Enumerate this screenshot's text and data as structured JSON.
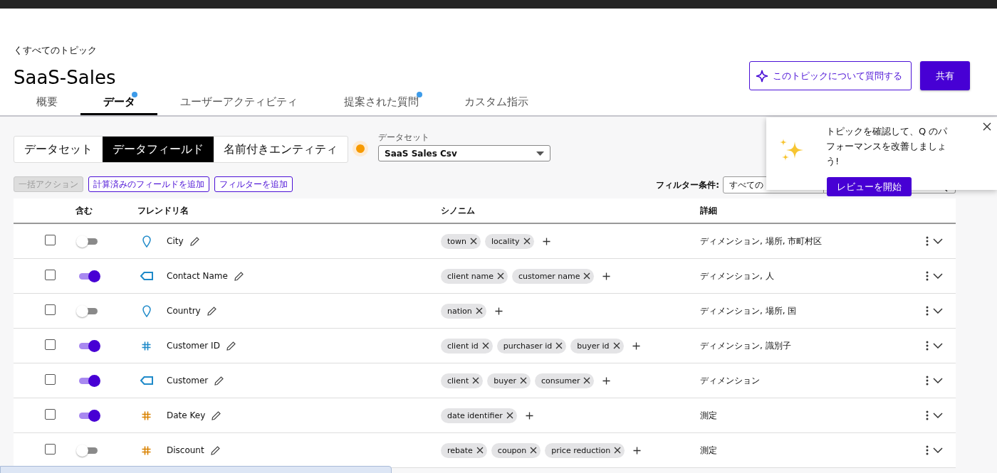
{
  "header": {
    "back_link": "くすべてのトピック",
    "title": "SaaS-Sales",
    "ask_button": "このトピックについて質問する",
    "share_button": "共有"
  },
  "tabs": [
    {
      "label": "概要",
      "selected": false,
      "dot": false
    },
    {
      "label": "データ",
      "selected": true,
      "dot": true
    },
    {
      "label": "ユーザーアクティビティ",
      "selected": false,
      "dot": false
    },
    {
      "label": "提案された質問",
      "selected": false,
      "dot": true
    },
    {
      "label": "カスタム指示",
      "selected": false,
      "dot": false
    }
  ],
  "segments": [
    {
      "label": "データセット",
      "selected": false
    },
    {
      "label": "データフィールド",
      "selected": true
    },
    {
      "label": "名前付きエンティティ",
      "selected": false
    }
  ],
  "dataset": {
    "label": "データセット",
    "value": "SaaS Sales Csv"
  },
  "actions": [
    {
      "label": "一括アクション",
      "disabled": true
    },
    {
      "label": "計算済みのフィールドを追加",
      "disabled": false
    },
    {
      "label": "フィルターを追加",
      "disabled": false
    }
  ],
  "filter": {
    "label": "フィルター条件:",
    "value": "すべての"
  },
  "table": {
    "columns": [
      "含む",
      "フレンドリ名",
      "シノニム",
      "詳細"
    ],
    "rows": [
      {
        "checked": false,
        "included": false,
        "kind": "location",
        "color": "#1f8ac9",
        "name": "City",
        "synonyms": [
          "town",
          "locality"
        ],
        "details": "ディメンション, 場所, 市町村区"
      },
      {
        "checked": false,
        "included": true,
        "kind": "text",
        "color": "#1f8ac9",
        "name": "Contact Name",
        "synonyms": [
          "client name",
          "customer name"
        ],
        "details": "ディメンション, 人"
      },
      {
        "checked": false,
        "included": false,
        "kind": "location",
        "color": "#1f8ac9",
        "name": "Country",
        "synonyms": [
          "nation"
        ],
        "details": "ディメンション, 場所, 国"
      },
      {
        "checked": false,
        "included": true,
        "kind": "number",
        "color": "#1f8ac9",
        "name": "Customer ID",
        "synonyms": [
          "client id",
          "purchaser id",
          "buyer id"
        ],
        "details": "ディメンション, 識別子"
      },
      {
        "checked": false,
        "included": true,
        "kind": "text",
        "color": "#1f8ac9",
        "name": "Customer",
        "synonyms": [
          "client",
          "buyer",
          "consumer"
        ],
        "details": "ディメンション"
      },
      {
        "checked": false,
        "included": true,
        "kind": "number",
        "color": "#d98200",
        "name": "Date Key",
        "synonyms": [
          "date identifier"
        ],
        "details": "測定"
      },
      {
        "checked": false,
        "included": false,
        "kind": "number",
        "color": "#d98200",
        "name": "Discount",
        "synonyms": [
          "rebate",
          "coupon",
          "price reduction"
        ],
        "details": "測定"
      }
    ]
  },
  "popup": {
    "message": "トピックを確認して、Q のパフォーマンスを改善しましょう!",
    "button": "レビューを開始"
  }
}
